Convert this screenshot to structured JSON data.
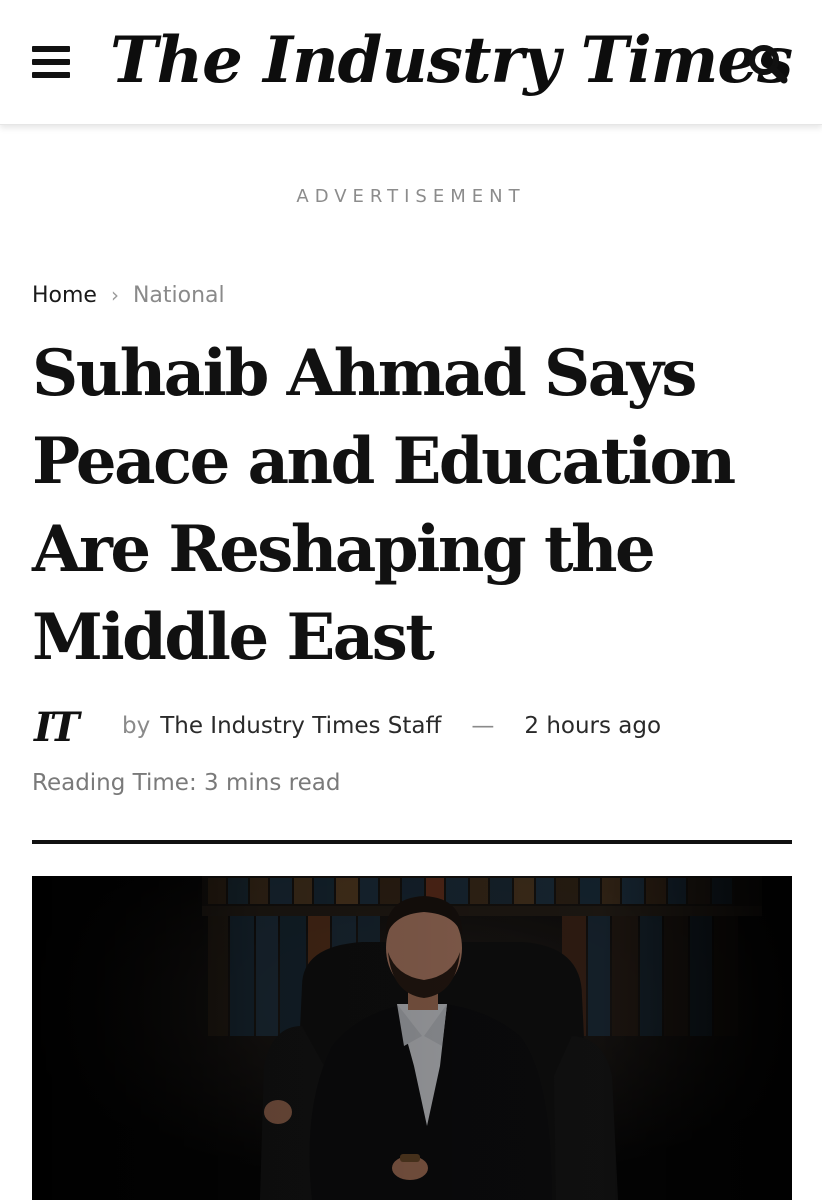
{
  "header": {
    "logo_text": "The Industry Times",
    "menu_icon": "hamburger-menu-icon",
    "search_icon": "search-icon"
  },
  "advertisement": {
    "label": "ADVERTISEMENT"
  },
  "breadcrumb": {
    "home": "Home",
    "separator": "›",
    "category": "National"
  },
  "article": {
    "title": "Suhaib Ahmad Says Peace and Education Are Reshaping the Middle East",
    "author_logo": "IT",
    "by_label": "by",
    "author": "The Industry Times Staff",
    "dash": "—",
    "published": "2 hours ago",
    "reading_time": "Reading Time: 3 mins read",
    "featured_image": "portrait-photo"
  },
  "colors": {
    "text": "#111111",
    "muted": "#8a8a8a",
    "background": "#ffffff"
  }
}
